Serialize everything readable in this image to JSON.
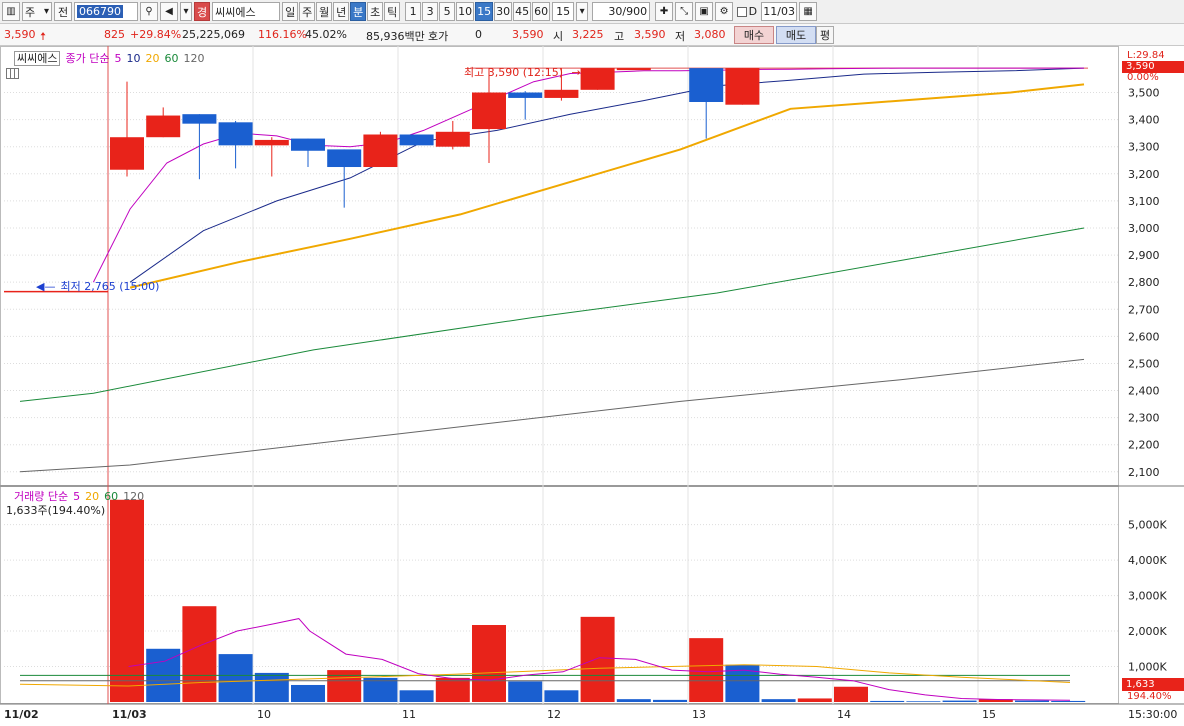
{
  "toolbar": {
    "market": "주",
    "prev_label": "전",
    "code": "066790",
    "tag": "경",
    "stock_name": "씨씨에스",
    "periods": [
      "일",
      "주",
      "월",
      "년",
      "분",
      "초",
      "틱"
    ],
    "selected_period": "분",
    "intervals": [
      "1",
      "3",
      "5",
      "10",
      "15",
      "30",
      "45",
      "60"
    ],
    "selected_interval": "15",
    "interval_value": "15",
    "count": "30/900",
    "d_label": "D",
    "date": "11/03"
  },
  "info": {
    "price": "3,590",
    "price_arrow": "up",
    "change": "825",
    "change_rate": "+29.84%",
    "volume": "25,225,069",
    "volume_rate": "116.16%",
    "turnover": "45.02%",
    "amount": "85,936백만",
    "quote_label": "호가",
    "quote_value": "0",
    "quote_price": "3,590",
    "open_label": "시",
    "open": "3,225",
    "high_label": "고",
    "high": "3,590",
    "low_label": "저",
    "low": "3,080",
    "buy_label": "매수",
    "sell_label": "매도",
    "avg_label": "평"
  },
  "price_legend": {
    "name": "씨씨에스",
    "label": "종가 단순",
    "periods": [
      "5",
      "10",
      "20",
      "60",
      "120"
    ],
    "colors": [
      "#c000c0",
      "#1a2a8a",
      "#f0a800",
      "#1a8a3a",
      "#666666"
    ]
  },
  "volume_legend": {
    "label": "거래량 단순",
    "periods": [
      "5",
      "20",
      "60",
      "120"
    ],
    "colors": [
      "#c000c0",
      "#f0a800",
      "#1a8a3a",
      "#666666"
    ],
    "current": "1,633주(194.40%)"
  },
  "annotations": {
    "high": "최고 3,590 (12:15)",
    "low": "최저 2,765 (15:00)"
  },
  "right_labels": {
    "limit": "L:29.84",
    "current_price": "3,590",
    "current_pct": "0.00%",
    "current_volume": "1,633",
    "current_volume_pct": "194.40%"
  },
  "colors": {
    "up": "#e8231a",
    "down": "#1a5fd0",
    "grid": "#dddddd"
  },
  "chart_data": [
    {
      "type": "candlestick",
      "title": "씨씨에스",
      "x_labels": [
        "11/02",
        "11/03",
        "10",
        "11",
        "12",
        "13",
        "14",
        "15"
      ],
      "yticks": [
        2100,
        2200,
        2300,
        2400,
        2500,
        2600,
        2700,
        2800,
        2900,
        3000,
        3100,
        3200,
        3300,
        3400,
        3500
      ],
      "ylim": [
        2055,
        3620
      ],
      "last_close_prev_day": 2765,
      "candles": [
        {
          "o": 3215,
          "h": 3540,
          "l": 3190,
          "c": 3335
        },
        {
          "o": 3335,
          "h": 3445,
          "l": 3335,
          "c": 3415
        },
        {
          "o": 3420,
          "h": 3420,
          "l": 3180,
          "c": 3385
        },
        {
          "o": 3390,
          "h": 3395,
          "l": 3220,
          "c": 3305
        },
        {
          "o": 3305,
          "h": 3335,
          "l": 3190,
          "c": 3325
        },
        {
          "o": 3330,
          "h": 3330,
          "l": 3225,
          "c": 3285
        },
        {
          "o": 3290,
          "h": 3290,
          "l": 3075,
          "c": 3225
        },
        {
          "o": 3225,
          "h": 3355,
          "l": 3225,
          "c": 3345
        },
        {
          "o": 3345,
          "h": 3345,
          "l": 3310,
          "c": 3305
        },
        {
          "o": 3300,
          "h": 3395,
          "l": 3290,
          "c": 3355
        },
        {
          "o": 3365,
          "h": 3590,
          "l": 3240,
          "c": 3500
        },
        {
          "o": 3500,
          "h": 3505,
          "l": 3400,
          "c": 3480
        },
        {
          "o": 3480,
          "h": 3590,
          "l": 3470,
          "c": 3510
        },
        {
          "o": 3510,
          "h": 3590,
          "l": 3510,
          "c": 3590
        },
        {
          "o": 3590,
          "h": 3590,
          "l": 3590,
          "c": 3590
        },
        {
          "o": 3590,
          "h": 3590,
          "l": 3590,
          "c": 3590
        },
        {
          "o": 3590,
          "h": 3590,
          "l": 3330,
          "c": 3465
        },
        {
          "o": 3455,
          "h": 3590,
          "l": 3455,
          "c": 3590
        },
        {
          "o": 3590,
          "h": 3590,
          "l": 3590,
          "c": 3590
        },
        {
          "o": 3590,
          "h": 3590,
          "l": 3590,
          "c": 3590
        },
        {
          "o": 3590,
          "h": 3590,
          "l": 3590,
          "c": 3590
        },
        {
          "o": 3590,
          "h": 3590,
          "l": 3590,
          "c": 3590
        },
        {
          "o": 3590,
          "h": 3590,
          "l": 3590,
          "c": 3590
        },
        {
          "o": 3590,
          "h": 3590,
          "l": 3590,
          "c": 3590
        },
        {
          "o": 3590,
          "h": 3590,
          "l": 3590,
          "c": 3590
        },
        {
          "o": 3590,
          "h": 3590,
          "l": 3590,
          "c": 3590
        },
        {
          "o": 3590,
          "h": 3590,
          "l": 3590,
          "c": 3590
        },
        {
          "o": 3590,
          "h": 3590,
          "l": 3590,
          "c": 3590
        }
      ],
      "ma5": [
        [
          2,
          2800
        ],
        [
          3,
          3070
        ],
        [
          4,
          3240
        ],
        [
          5,
          3310
        ],
        [
          6,
          3350
        ],
        [
          7,
          3340
        ],
        [
          8,
          3305
        ],
        [
          9,
          3300
        ],
        [
          10,
          3315
        ],
        [
          11,
          3360
        ],
        [
          12,
          3420
        ],
        [
          13,
          3480
        ],
        [
          14,
          3540
        ],
        [
          15,
          3570
        ],
        [
          16,
          3575
        ],
        [
          17,
          3580
        ],
        [
          18,
          3580
        ],
        [
          19,
          3582
        ],
        [
          20,
          3585
        ],
        [
          21,
          3586
        ],
        [
          22,
          3588
        ],
        [
          23,
          3589
        ],
        [
          24,
          3590
        ],
        [
          25,
          3590
        ],
        [
          26,
          3590
        ],
        [
          27,
          3590
        ],
        [
          28,
          3590
        ],
        [
          29,
          3590
        ]
      ],
      "ma10": [
        [
          3,
          2800
        ],
        [
          5,
          2990
        ],
        [
          7,
          3100
        ],
        [
          9,
          3185
        ],
        [
          11,
          3320
        ],
        [
          13,
          3360
        ],
        [
          15,
          3420
        ],
        [
          17,
          3470
        ],
        [
          19,
          3525
        ],
        [
          21,
          3545
        ],
        [
          23,
          3568
        ],
        [
          25,
          3575
        ],
        [
          27,
          3580
        ],
        [
          29,
          3590
        ]
      ],
      "ma20": [
        [
          3,
          2780
        ],
        [
          6,
          2875
        ],
        [
          9,
          2960
        ],
        [
          12,
          3050
        ],
        [
          15,
          3170
        ],
        [
          18,
          3290
        ],
        [
          21,
          3440
        ],
        [
          24,
          3470
        ],
        [
          27,
          3500
        ],
        [
          29,
          3530
        ]
      ],
      "ma60": [
        [
          0,
          2360
        ],
        [
          2,
          2390
        ],
        [
          8,
          2550
        ],
        [
          14,
          2670
        ],
        [
          19,
          2760
        ],
        [
          24,
          2880
        ],
        [
          29,
          3000
        ]
      ],
      "ma120": [
        [
          0,
          2100
        ],
        [
          3,
          2125
        ],
        [
          10,
          2235
        ],
        [
          18,
          2360
        ],
        [
          24,
          2440
        ],
        [
          29,
          2515
        ]
      ]
    },
    {
      "type": "bar",
      "title": "거래량",
      "yticks": [
        1000,
        2000,
        3000,
        4000,
        5000
      ],
      "ytick_labels": [
        "1,000K",
        "2,000K",
        "3,000K",
        "4,000K",
        "5,000K"
      ],
      "ylim": [
        0,
        5750
      ],
      "unit": "K",
      "bars": [
        {
          "v": 0,
          "up": true
        },
        {
          "v": 0,
          "up": true
        },
        {
          "v": 0,
          "up": true
        },
        {
          "v": 5700,
          "up": true
        },
        {
          "v": 1500,
          "up": false
        },
        {
          "v": 2700,
          "up": true
        },
        {
          "v": 1350,
          "up": false
        },
        {
          "v": 820,
          "up": false
        },
        {
          "v": 480,
          "up": false
        },
        {
          "v": 900,
          "up": true
        },
        {
          "v": 680,
          "up": false
        },
        {
          "v": 330,
          "up": false
        },
        {
          "v": 680,
          "up": true
        },
        {
          "v": 2170,
          "up": true
        },
        {
          "v": 580,
          "up": false
        },
        {
          "v": 330,
          "up": false
        },
        {
          "v": 2400,
          "up": true
        },
        {
          "v": 80,
          "up": false
        },
        {
          "v": 60,
          "up": false
        },
        {
          "v": 1800,
          "up": true
        },
        {
          "v": 1050,
          "up": false
        },
        {
          "v": 80,
          "up": false
        },
        {
          "v": 100,
          "up": true
        },
        {
          "v": 430,
          "up": true
        },
        {
          "v": 30,
          "up": false
        },
        {
          "v": 20,
          "up": false
        },
        {
          "v": 40,
          "up": false
        },
        {
          "v": 80,
          "up": true
        },
        {
          "v": 40,
          "up": false
        },
        {
          "v": 30,
          "up": false
        }
      ],
      "ma5": [
        [
          3,
          1000
        ],
        [
          4,
          1150
        ],
        [
          5,
          1600
        ],
        [
          6,
          2000
        ],
        [
          7,
          2200
        ],
        [
          7.7,
          2350
        ],
        [
          8,
          2000
        ],
        [
          9,
          1350
        ],
        [
          10,
          1200
        ],
        [
          11,
          800
        ],
        [
          12,
          650
        ],
        [
          13,
          620
        ],
        [
          14,
          760
        ],
        [
          15,
          850
        ],
        [
          16,
          1250
        ],
        [
          17,
          1200
        ],
        [
          18,
          900
        ],
        [
          19,
          850
        ],
        [
          20,
          900
        ],
        [
          21,
          780
        ],
        [
          22,
          700
        ],
        [
          23,
          600
        ],
        [
          24,
          350
        ],
        [
          25,
          200
        ],
        [
          26,
          100
        ],
        [
          27,
          70
        ],
        [
          28,
          60
        ],
        [
          29,
          50
        ]
      ],
      "ma20": [
        [
          0,
          500
        ],
        [
          3,
          450
        ],
        [
          5,
          550
        ],
        [
          8,
          650
        ],
        [
          12,
          780
        ],
        [
          16,
          950
        ],
        [
          20,
          1050
        ],
        [
          22,
          1000
        ],
        [
          24,
          820
        ],
        [
          26,
          700
        ],
        [
          29,
          550
        ]
      ],
      "ma60": [
        [
          0,
          750
        ],
        [
          29,
          750
        ]
      ],
      "ma120": [
        [
          0,
          600
        ],
        [
          29,
          600
        ]
      ]
    }
  ]
}
